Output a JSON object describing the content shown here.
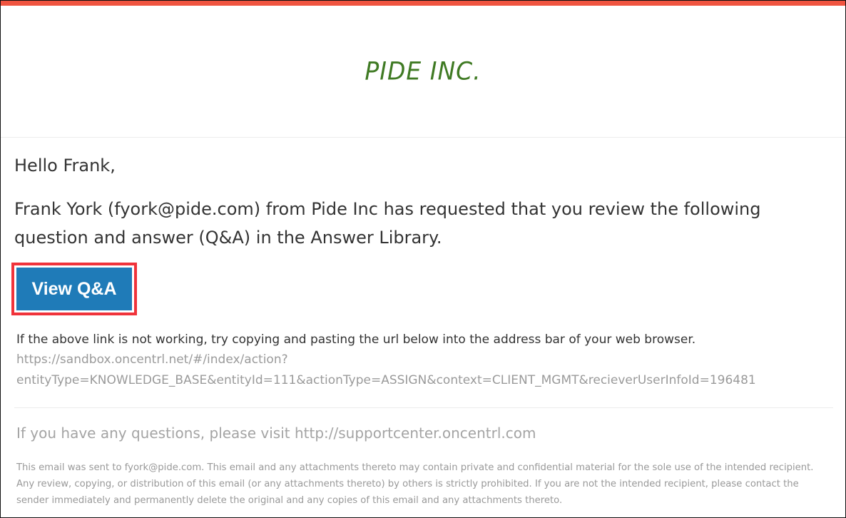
{
  "colors": {
    "accent": "#f05440",
    "logo": "#3f7a23",
    "button": "#1f7bb8",
    "highlight_border": "#f0333b"
  },
  "header": {
    "logo_text": "PIDE INC."
  },
  "body": {
    "greeting": "Hello Frank,",
    "request_text": "Frank York (fyork@pide.com) from Pide Inc has requested that you review the following question and answer (Q&A) in the Answer Library.",
    "button_label": "View Q&A",
    "fallback_text": "If the above link is not working, try copying and pasting the url below into the address bar of your web browser.",
    "url_line_1": "https://sandbox.oncentrl.net/#/index/action?",
    "url_line_2": "entityType=KNOWLEDGE_BASE&entityId=111&actionType=ASSIGN&context=CLIENT_MGMT&recieverUserInfoId=196481"
  },
  "footer": {
    "support_text": "If you have any questions, please visit http://supportcenter.oncentrl.com",
    "legal_text": "This email was sent to fyork@pide.com. This email and any attachments thereto may contain private and confidential material for the sole use of the intended recipient. Any review, copying, or distribution of this email (or any attachments thereto) by others is strictly prohibited. If you are not the intended recipient, please contact the sender immediately and permanently delete the original and any copies of this email and any attachments thereto."
  }
}
